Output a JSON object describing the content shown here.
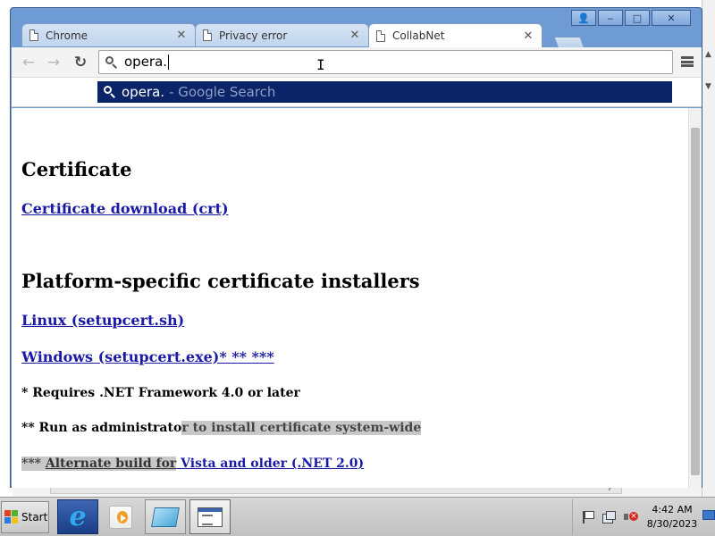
{
  "browser": {
    "tabs": [
      {
        "title": "Chrome",
        "close": "✕"
      },
      {
        "title": "Privacy error",
        "close": "✕"
      },
      {
        "title": "CollabNet",
        "close": "✕"
      }
    ],
    "active_tab": 2,
    "omnibox": {
      "value": "opera."
    },
    "suggestion": {
      "query": "opera.",
      "hint": "- Google Search"
    },
    "caption_buttons": {
      "user": "👤",
      "minimize": "‒",
      "maximize": "□",
      "close": "✕"
    }
  },
  "page": {
    "heading_certificate": "Certificate",
    "link_cert_download": "Certificate download (crt)",
    "heading_installers": "Platform-specific certificate installers",
    "link_linux": "Linux (setupcert.sh)",
    "link_windows": "Windows (setupcert.exe)* ** ***",
    "note_1": "* Requires .NET Framework 4.0 or later",
    "note_2_plain": "** Run as administrato",
    "note_2_highlight": "r to install certificate system-wide",
    "note_3_prefix": "*** ",
    "note_3_link_hl": "Alternate build for",
    "note_3_link_rest": " Vista and older (.NET 2.0)"
  },
  "taskbar": {
    "start_label": "Start",
    "clock_time": "4:42 AM",
    "clock_date": "8/30/2023"
  },
  "colors": {
    "link": "#1a1aa6",
    "suggestion_highlight": "#0b2467",
    "window_frame": "#6e9bd3"
  }
}
